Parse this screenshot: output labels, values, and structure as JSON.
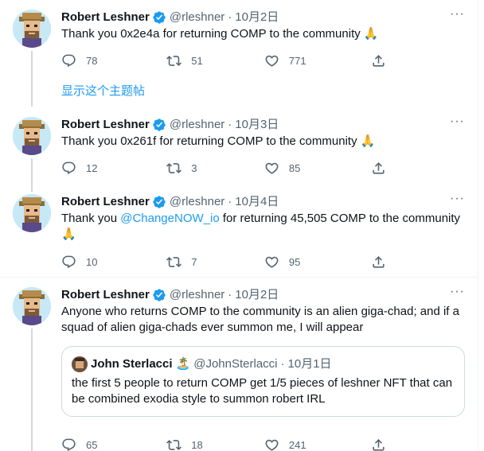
{
  "tweets": [
    {
      "name": "Robert Leshner",
      "handle": "@rleshner",
      "separator": "·",
      "date": "10月2日",
      "text": "Thank you 0x2e4a for returning COMP to the community 🙏",
      "replies": "78",
      "retweets": "51",
      "likes": "771"
    },
    {
      "name": "Robert Leshner",
      "handle": "@rleshner",
      "separator": "·",
      "date": "10月3日",
      "text": "Thank you 0x261f for returning COMP to the community 🙏",
      "replies": "12",
      "retweets": "3",
      "likes": "85"
    },
    {
      "name": "Robert Leshner",
      "handle": "@rleshner",
      "separator": "·",
      "date": "10月4日",
      "text_before": "Thank you ",
      "mention": "@ChangeNOW_io",
      "text_after": " for returning 45,505 COMP to the community 🙏",
      "replies": "10",
      "retweets": "7",
      "likes": "95"
    },
    {
      "name": "Robert Leshner",
      "handle": "@rleshner",
      "separator": "·",
      "date": "10月2日",
      "text": "Anyone who returns COMP to the community is an alien giga-chad; and if a squad of alien giga-chads ever summon me, I will appear",
      "replies": "65",
      "retweets": "18",
      "likes": "241"
    }
  ],
  "show_thread": "显示这个主题帖",
  "more_label": "···",
  "quote": {
    "name": "John Sterlacci",
    "badge": "🏝️",
    "handle": "@JohnSterlacci",
    "separator": "·",
    "date": "10月1日",
    "text": "the first 5 people to return COMP get 1/5 pieces of leshner NFT that can be combined exodia style to summon robert IRL"
  },
  "colors": {
    "accent": "#1d9bf0",
    "secondary_text": "#536471",
    "border": "#eff3f4"
  },
  "icons": {
    "reply": "reply-icon",
    "retweet": "retweet-icon",
    "like": "heart-icon",
    "share": "share-icon",
    "verified": "verified-badge-icon"
  }
}
